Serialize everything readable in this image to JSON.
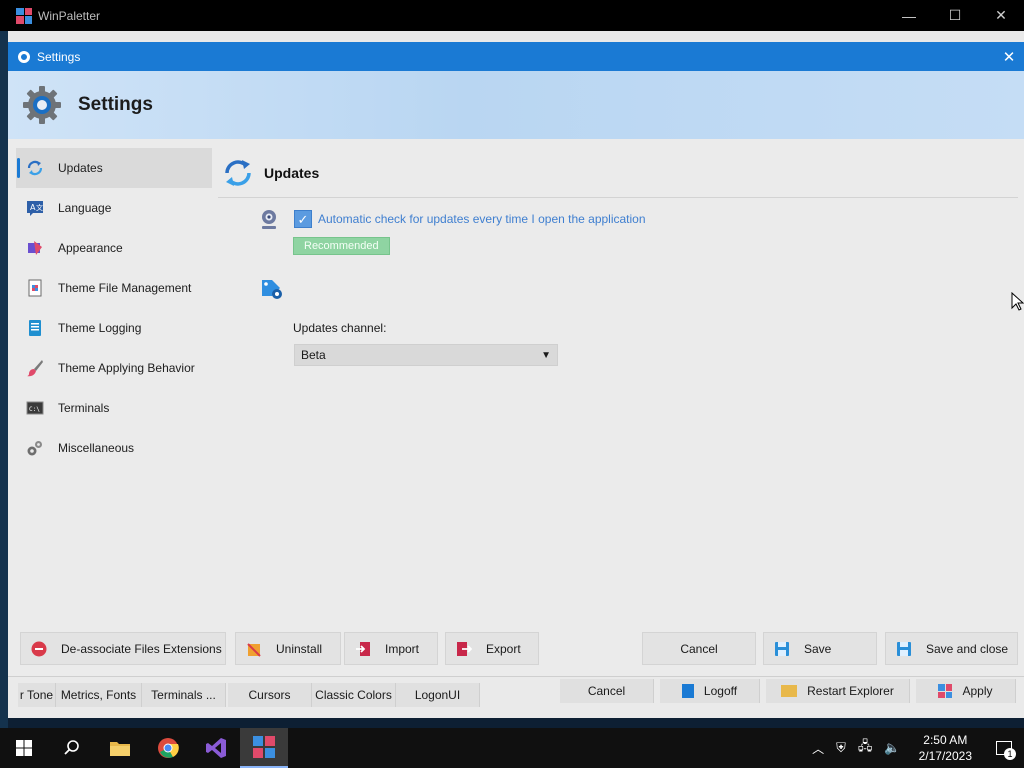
{
  "main_window": {
    "title": "WinPaletter",
    "controls": [
      "—",
      "☐",
      "✕"
    ]
  },
  "settings": {
    "title": "Settings",
    "close": "✕",
    "heading": "Settings",
    "nav": [
      {
        "label": "Updates",
        "icon": "sync-icon",
        "active": true
      },
      {
        "label": "Language",
        "icon": "language-icon"
      },
      {
        "label": "Appearance",
        "icon": "appearance-icon"
      },
      {
        "label": "Theme File Management",
        "icon": "theme-file-icon"
      },
      {
        "label": "Theme Logging",
        "icon": "log-book-icon"
      },
      {
        "label": "Theme Applying Behavior",
        "icon": "brush-icon"
      },
      {
        "label": "Terminals",
        "icon": "terminal-icon"
      },
      {
        "label": "Miscellaneous",
        "icon": "gears-icon"
      }
    ],
    "section": {
      "title": "Updates",
      "auto_check_label": "Automatic check for updates every time I open the application",
      "auto_check_checked": true,
      "recommended_badge": "Recommended",
      "channel_label": "Updates channel:",
      "channel_value": "Beta"
    },
    "buttons": {
      "deassociate": "De-associate Files Extensions",
      "uninstall": "Uninstall",
      "import": "Import",
      "export": "Export",
      "cancel": "Cancel",
      "save": "Save",
      "save_close": "Save and close"
    }
  },
  "lower_strip": {
    "tabs": [
      "r Tone",
      "Metrics, Fonts",
      "Terminals ...",
      "Cursors",
      "Classic Colors",
      "LogonUI"
    ],
    "cancel": "Cancel",
    "logoff": "Logoff",
    "restart_explorer": "Restart Explorer",
    "apply": "Apply"
  },
  "taskbar": {
    "time": "2:50 AM",
    "date": "2/17/2023",
    "notification_count": "1"
  },
  "colors": {
    "accent": "#1a7ad4",
    "link": "#3f7fd0",
    "badge": "#8fd4a2"
  }
}
